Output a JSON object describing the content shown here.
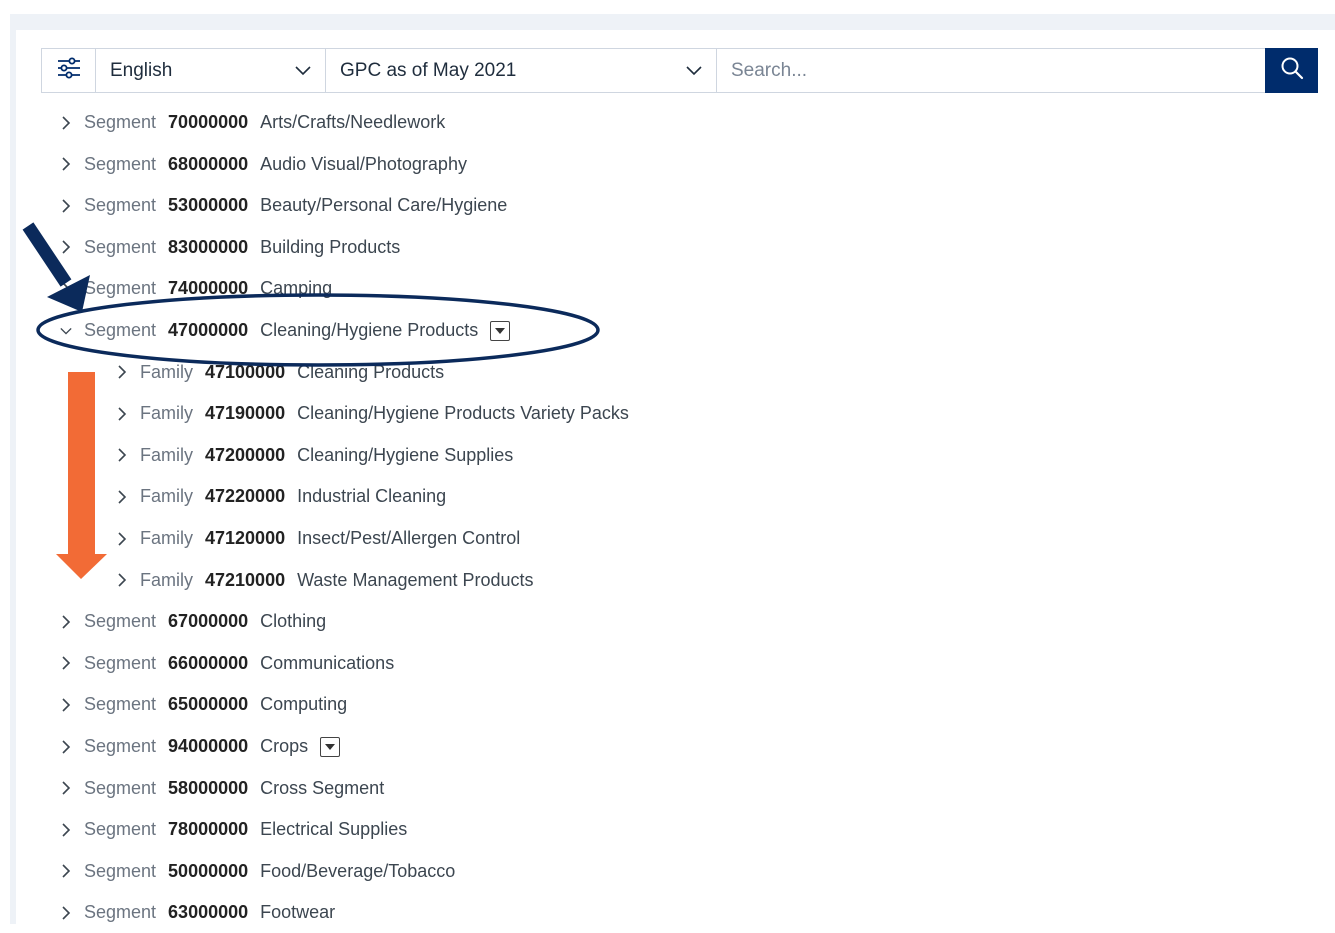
{
  "toolbar": {
    "language": "English",
    "version": "GPC as of May 2021",
    "search_placeholder": "Search..."
  },
  "icons": {
    "filter": "sliders-icon",
    "search": "search-icon",
    "collapsed": "chevron-right-icon",
    "expanded": "chevron-down-icon",
    "menu": "dropdown-menu-icon"
  },
  "colors": {
    "brand": "#002c6c",
    "ellipse": "#0b2a5b",
    "arrow_blue": "#0b2a5b",
    "arrow_orange": "#f26b36"
  },
  "tree": [
    {
      "kind": "Segment",
      "code": "70000000",
      "title": "Arts/Crafts/Needlework",
      "level": 0,
      "expanded": false,
      "menu": false
    },
    {
      "kind": "Segment",
      "code": "68000000",
      "title": "Audio Visual/Photography",
      "level": 0,
      "expanded": false,
      "menu": false
    },
    {
      "kind": "Segment",
      "code": "53000000",
      "title": "Beauty/Personal Care/Hygiene",
      "level": 0,
      "expanded": false,
      "menu": false
    },
    {
      "kind": "Segment",
      "code": "83000000",
      "title": "Building Products",
      "level": 0,
      "expanded": false,
      "menu": false
    },
    {
      "kind": "Segment",
      "code": "74000000",
      "title": "Camping",
      "level": 0,
      "expanded": false,
      "menu": false
    },
    {
      "kind": "Segment",
      "code": "47000000",
      "title": "Cleaning/Hygiene Products",
      "level": 0,
      "expanded": true,
      "menu": true
    },
    {
      "kind": "Family",
      "code": "47100000",
      "title": "Cleaning Products",
      "level": 1,
      "expanded": false,
      "menu": false
    },
    {
      "kind": "Family",
      "code": "47190000",
      "title": "Cleaning/Hygiene Products Variety Packs",
      "level": 1,
      "expanded": false,
      "menu": false
    },
    {
      "kind": "Family",
      "code": "47200000",
      "title": "Cleaning/Hygiene Supplies",
      "level": 1,
      "expanded": false,
      "menu": false
    },
    {
      "kind": "Family",
      "code": "47220000",
      "title": "Industrial Cleaning",
      "level": 1,
      "expanded": false,
      "menu": false
    },
    {
      "kind": "Family",
      "code": "47120000",
      "title": "Insect/Pest/Allergen Control",
      "level": 1,
      "expanded": false,
      "menu": false
    },
    {
      "kind": "Family",
      "code": "47210000",
      "title": "Waste Management Products",
      "level": 1,
      "expanded": false,
      "menu": false
    },
    {
      "kind": "Segment",
      "code": "67000000",
      "title": "Clothing",
      "level": 0,
      "expanded": false,
      "menu": false
    },
    {
      "kind": "Segment",
      "code": "66000000",
      "title": "Communications",
      "level": 0,
      "expanded": false,
      "menu": false
    },
    {
      "kind": "Segment",
      "code": "65000000",
      "title": "Computing",
      "level": 0,
      "expanded": false,
      "menu": false
    },
    {
      "kind": "Segment",
      "code": "94000000",
      "title": "Crops",
      "level": 0,
      "expanded": false,
      "menu": true
    },
    {
      "kind": "Segment",
      "code": "58000000",
      "title": "Cross Segment",
      "level": 0,
      "expanded": false,
      "menu": false
    },
    {
      "kind": "Segment",
      "code": "78000000",
      "title": "Electrical Supplies",
      "level": 0,
      "expanded": false,
      "menu": false
    },
    {
      "kind": "Segment",
      "code": "50000000",
      "title": "Food/Beverage/Tobacco",
      "level": 0,
      "expanded": false,
      "menu": false
    },
    {
      "kind": "Segment",
      "code": "63000000",
      "title": "Footwear",
      "level": 0,
      "expanded": false,
      "menu": false
    }
  ]
}
